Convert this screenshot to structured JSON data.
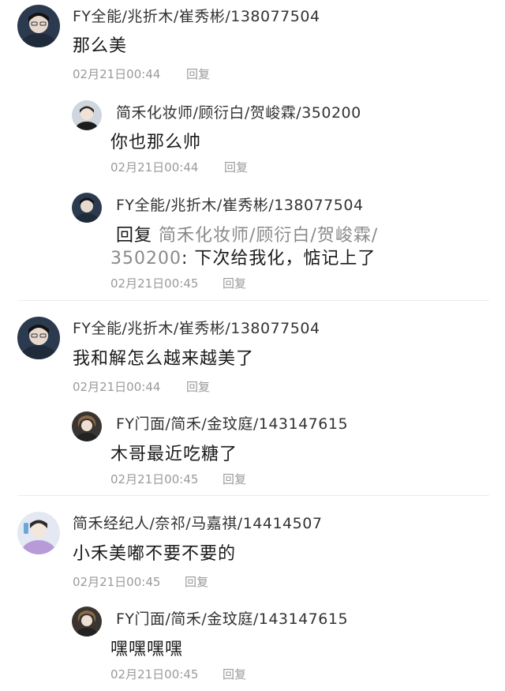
{
  "comments": [
    {
      "name": "FY全能/兆折木/崔秀彬/138077504",
      "text": "那么美",
      "time": "02月21日00:44",
      "reply": "回复",
      "replies": [
        {
          "name": "简禾化妆师/顾衍白/贺峻霖/350200",
          "text": "你也那么帅",
          "time": "02月21日00:44",
          "reply": "回复"
        },
        {
          "name": "FY全能/兆折木/崔秀彬/138077504",
          "text_prefix": "回复",
          "quote_line1": "简禾化妆师/顾衍白/贺峻霖/",
          "quote_line2": "350200",
          "text": ": 下次给我化，惦记上了",
          "time": "02月21日00:45",
          "reply": "回复"
        }
      ]
    },
    {
      "name": "FY全能/兆折木/崔秀彬/138077504",
      "text": "我和解怎么越来越美了",
      "time": "02月21日00:44",
      "reply": "回复",
      "replies": [
        {
          "name": "FY门面/简禾/金玟庭/143147615",
          "text": "木哥最近吃糖了",
          "time": "02月21日00:45",
          "reply": "回复"
        }
      ]
    },
    {
      "name": "简禾经纪人/奈祁/马嘉祺/14414507",
      "text": "小禾美嘟不要不要的",
      "time": "02月21日00:45",
      "reply": "回复",
      "replies": [
        {
          "name": "FY门面/简禾/金玟庭/143147615",
          "text": "嘿嘿嘿嘿",
          "time": "02月21日00:45",
          "reply": "回复"
        }
      ]
    }
  ],
  "colors": {
    "name": "#333333",
    "text": "#1a1a1a",
    "meta": "#9a9a9a",
    "divider": "#ececec"
  }
}
